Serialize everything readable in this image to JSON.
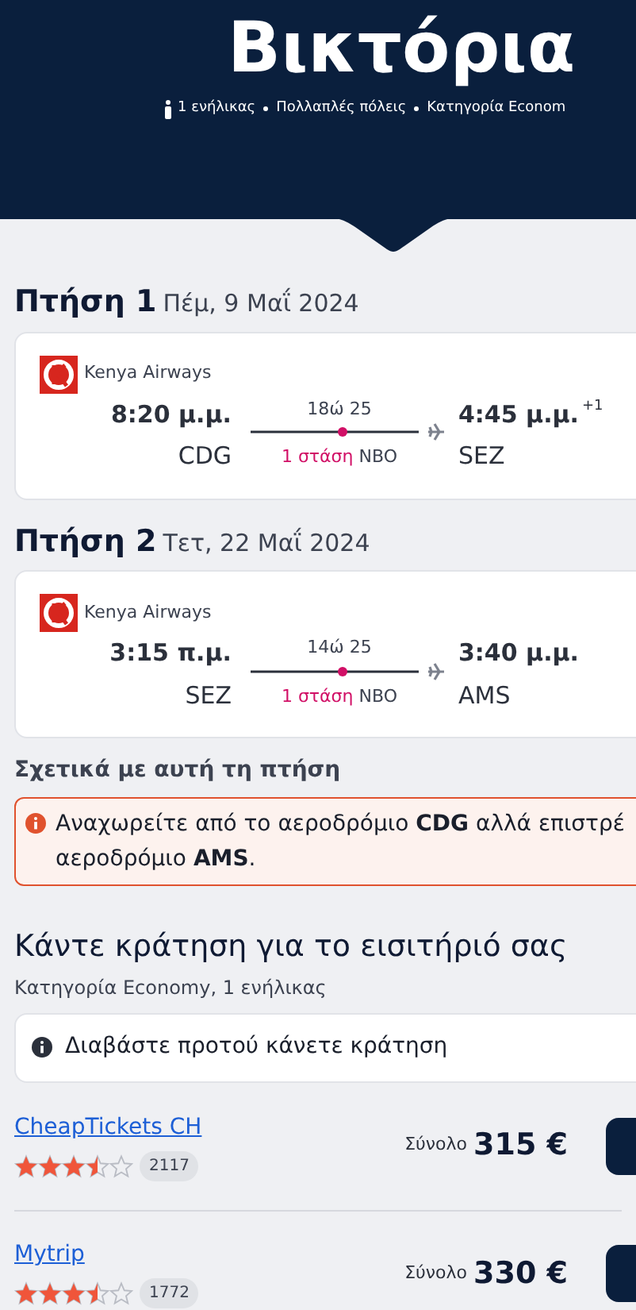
{
  "header": {
    "title": "Βικτόρια",
    "details": [
      "1 ενήλικας",
      "Πολλαπλές πόλεις",
      "Κατηγορία Econom"
    ]
  },
  "flights": [
    {
      "label": "Πτήση 1",
      "date": "Πέμ, 9 Μαΐ 2024",
      "airline": "Kenya Airways",
      "depart_time": "8:20 μ.μ.",
      "depart_airport": "CDG",
      "duration": "18ώ 25",
      "stops": "1 στάση",
      "stop_airport": "NBO",
      "arrive_time": "4:45 μ.μ.",
      "day_offset": "+1",
      "arrive_airport": "SEZ"
    },
    {
      "label": "Πτήση 2",
      "date": "Τετ, 22 Μαΐ 2024",
      "airline": "Kenya Airways",
      "depart_time": "3:15 π.μ.",
      "depart_airport": "SEZ",
      "duration": "14ώ 25",
      "stops": "1 στάση",
      "stop_airport": "NBO",
      "arrive_time": "3:40 μ.μ.",
      "arrive_airport": "AMS"
    }
  ],
  "notice": {
    "heading": "Σχετικά με αυτή τη πτήση",
    "lines": [
      "Αναχωρείτε από το αεροδρόμιο **CDG** αλλά επιστρέ",
      "αεροδρόμιο **AMS**."
    ]
  },
  "booking": {
    "title": "Κάντε κράτηση για το εισιτήριό σας",
    "subtitle": "Κατηγορία Economy, 1 ενήλικας",
    "info": "Διαβάστε προτού κάνετε κράτηση",
    "offers": [
      {
        "name": "CheapTickets CH",
        "stars": 3.5,
        "reviews": "2117",
        "total_label": "Σύνολο",
        "price": "315 €"
      },
      {
        "name": "Mytrip",
        "stars": 3.5,
        "reviews": "1772",
        "total_label": "Σύνολο",
        "price": "330 €"
      }
    ]
  }
}
